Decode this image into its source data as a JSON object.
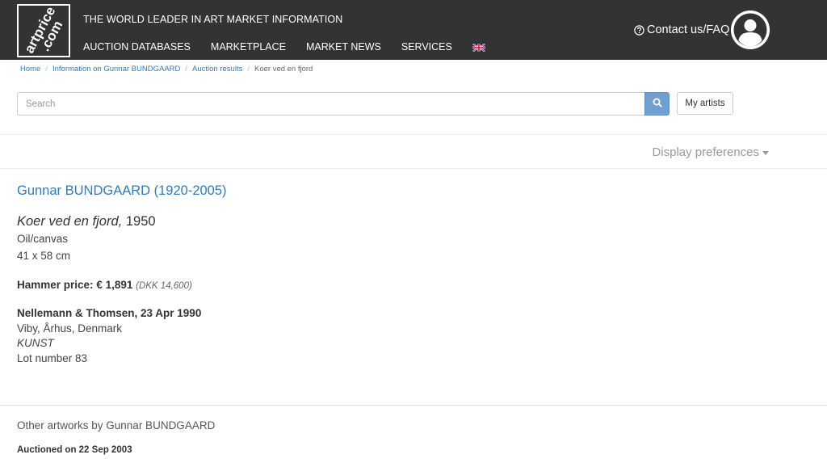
{
  "header": {
    "logo_text": "artprice .com",
    "tagline": "THE WORLD LEADER IN ART MARKET INFORMATION",
    "nav": [
      {
        "label": "AUCTION DATABASES"
      },
      {
        "label": "MARKETPLACE"
      },
      {
        "label": "MARKET NEWS"
      },
      {
        "label": "SERVICES"
      }
    ],
    "language_icon": "uk-flag-icon",
    "contact_label": "Contact us/FAQ",
    "colors": {
      "bar": "#333333",
      "text": "#ffffff"
    }
  },
  "breadcrumb": [
    {
      "label": "Home"
    },
    {
      "label": "Information on Gunnar BUNDGAARD"
    },
    {
      "label": "Auction results"
    },
    {
      "label": "Koer ved en fjord"
    }
  ],
  "search": {
    "placeholder": "Search",
    "value": "",
    "button_icon": "search-icon",
    "my_artists_label": "My artists",
    "button_color": "#6fa0cf"
  },
  "display_preferences_label": "Display preferences",
  "artwork": {
    "artist": "Gunnar BUNDGAARD (1920-2005)",
    "title": "Koer ved en fjord,",
    "year": "1950",
    "medium": "Oil/canvas",
    "dimensions": "41 x 58 cm",
    "hammer_label": "Hammer price:",
    "hammer_price": "€ 1,891",
    "hammer_local": "(DKK 14,600)",
    "auction_house": "Nellemann & Thomsen, 23 Apr 1990",
    "location": "Viby, Århus, Denmark",
    "sale_name": "KUNST",
    "lot": "Lot number 83",
    "link_color": "#337ab7"
  },
  "other": {
    "heading": "Other artworks by Gunnar BUNDGAARD",
    "auctioned": "Auctioned on 22 Sep 2003"
  }
}
